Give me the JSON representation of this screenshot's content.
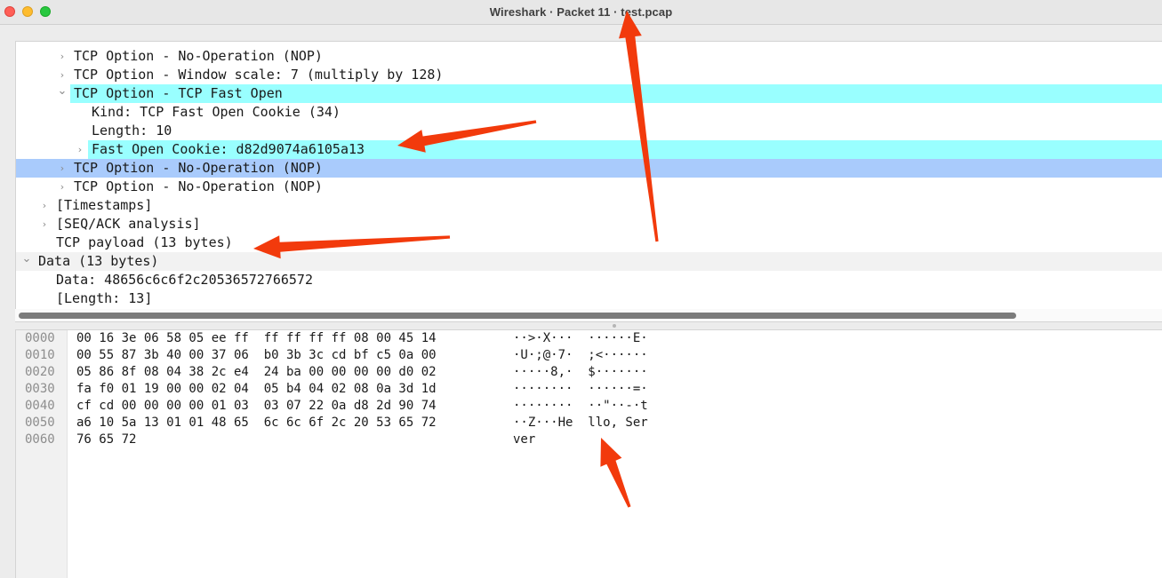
{
  "window": {
    "title": "Wireshark · Packet 11 · test.pcap"
  },
  "details": {
    "rows": [
      {
        "text": "TCP Option - No-Operation (NOP)",
        "level": 2,
        "disclosure": "collapsed",
        "highlight": "none"
      },
      {
        "text": "TCP Option - Window scale: 7 (multiply by 128)",
        "level": 2,
        "disclosure": "collapsed",
        "highlight": "none"
      },
      {
        "text": "TCP Option - TCP Fast Open",
        "level": 2,
        "disclosure": "expanded",
        "highlight": "cyan"
      },
      {
        "text": "Kind: TCP Fast Open Cookie (34)",
        "level": 3,
        "disclosure": "none",
        "highlight": "none"
      },
      {
        "text": "Length: 10",
        "level": 3,
        "disclosure": "none",
        "highlight": "none"
      },
      {
        "text": "Fast Open Cookie: d82d9074a6105a13",
        "level": 3,
        "disclosure": "collapsed",
        "highlight": "cyan"
      },
      {
        "text": "TCP Option - No-Operation (NOP)",
        "level": 2,
        "disclosure": "collapsed",
        "highlight": "selected"
      },
      {
        "text": "TCP Option - No-Operation (NOP)",
        "level": 2,
        "disclosure": "collapsed",
        "highlight": "none"
      },
      {
        "text": "[Timestamps]",
        "level": 1,
        "disclosure": "collapsed",
        "highlight": "none"
      },
      {
        "text": "[SEQ/ACK analysis]",
        "level": 1,
        "disclosure": "collapsed",
        "highlight": "none"
      },
      {
        "text": "TCP payload (13 bytes)",
        "level": 1,
        "disclosure": "none",
        "highlight": "none"
      },
      {
        "text": "Data (13 bytes)",
        "level": 0,
        "disclosure": "expanded",
        "highlight": "gray"
      },
      {
        "text": "Data: 48656c6c6f2c20536572766572",
        "level": 1,
        "disclosure": "none",
        "highlight": "none"
      },
      {
        "text": "[Length: 13]",
        "level": 1,
        "disclosure": "none",
        "highlight": "none"
      }
    ]
  },
  "bytes": {
    "lines": [
      {
        "offset": "0000",
        "hex": "00 16 3e 06 58 05 ee ff  ff ff ff ff 08 00 45 14",
        "ascii": "··>·X···  ······E·"
      },
      {
        "offset": "0010",
        "hex": "00 55 87 3b 40 00 37 06  b0 3b 3c cd bf c5 0a 00",
        "ascii": "·U·;@·7·  ;<······"
      },
      {
        "offset": "0020",
        "hex": "05 86 8f 08 04 38 2c e4  24 ba 00 00 00 00 d0 02",
        "ascii": "·····8,·  $·······"
      },
      {
        "offset": "0030",
        "hex": "fa f0 01 19 00 00 02 04  05 b4 04 02 08 0a 3d 1d",
        "ascii": "········  ······=·"
      },
      {
        "offset": "0040",
        "hex": "cf cd 00 00 00 00 01 03  03 07 22 0a d8 2d 90 74",
        "ascii": "········  ··\"··-·t"
      },
      {
        "offset": "0050",
        "hex": "a6 10 5a 13 01 01 48 65  6c 6c 6f 2c 20 53 65 72",
        "ascii": "··Z···He  llo, Ser"
      },
      {
        "offset": "0060",
        "hex": "76 65 72",
        "ascii": "ver"
      }
    ]
  },
  "colors": {
    "annotation_arrow": "#f23a0c",
    "highlight_cyan": "#99ffff",
    "selected_blue": "#a9cbfc"
  }
}
